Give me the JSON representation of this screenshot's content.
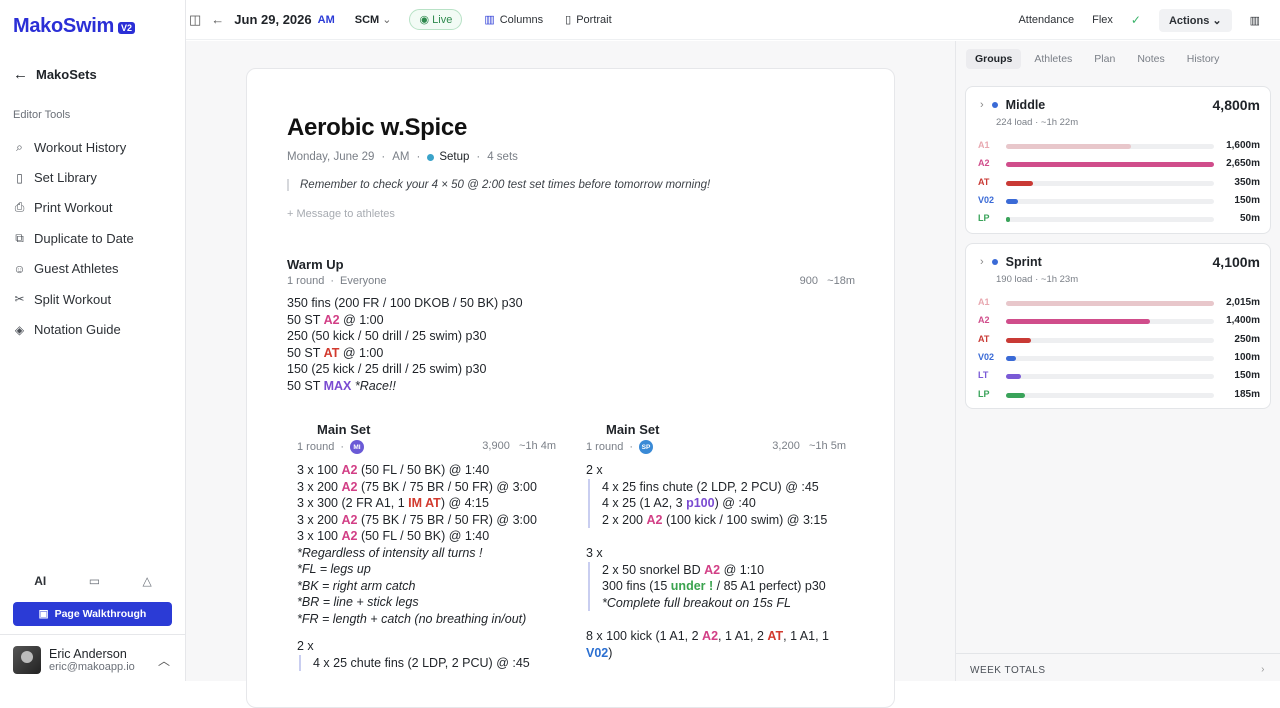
{
  "app": {
    "logo": "MakoSwim",
    "logo_badge": "V2"
  },
  "sidebar": {
    "back_label": "MakoSets",
    "section_label": "Editor Tools",
    "items": [
      {
        "label": "Workout History",
        "icon": "search-icon"
      },
      {
        "label": "Set Library",
        "icon": "book-icon"
      },
      {
        "label": "Print Workout",
        "icon": "printer-icon"
      },
      {
        "label": "Duplicate to Date",
        "icon": "copy-icon"
      },
      {
        "label": "Guest Athletes",
        "icon": "user-plus-icon"
      },
      {
        "label": "Split Workout",
        "icon": "scissors-icon"
      },
      {
        "label": "Notation Guide",
        "icon": "graduation-cap-icon"
      }
    ],
    "bottom_tabs": {
      "ai": "AI"
    },
    "walkthrough_label": "Page Walkthrough",
    "user": {
      "name": "Eric Anderson",
      "email": "eric@makoapp.io"
    }
  },
  "topbar": {
    "date": "Jun 29, 2026",
    "ampm": "AM",
    "course": "SCM",
    "live": "Live",
    "columns": "Columns",
    "portrait": "Portrait",
    "attendance": "Attendance",
    "flex": "Flex",
    "actions": "Actions"
  },
  "workout": {
    "title": "Aerobic w.Spice",
    "day": "Monday, June 29",
    "ampm": "AM",
    "type": "Setup",
    "sets": "4 sets",
    "note": "Remember to check your 4 × 50 @ 2:00 test set times before tomorrow morning!",
    "message_placeholder": "+ Message to athletes",
    "warmup": {
      "title": "Warm Up",
      "rounds": "1 round",
      "group": "Everyone",
      "distance": "900",
      "time": "~18m"
    },
    "main_left": {
      "title": "Main Set",
      "rounds": "1 round",
      "badge": "MI",
      "distance": "3,900",
      "time": "~1h 4m"
    },
    "main_right": {
      "title": "Main Set",
      "rounds": "1 round",
      "badge": "SP",
      "distance": "3,200",
      "time": "~1h 5m"
    }
  },
  "rpanel": {
    "tabs": [
      "Groups",
      "Athletes",
      "Plan",
      "Notes",
      "History"
    ],
    "groups": [
      {
        "name": "Middle",
        "total": "4,800m",
        "sub": "224 load · ~1h 22m",
        "bars": [
          {
            "label": "A1",
            "value": "1,600m",
            "fraction": 0.6,
            "color": "#e8c7cb",
            "label_color": "#e8a8b0"
          },
          {
            "label": "A2",
            "value": "2,650m",
            "fraction": 1.0,
            "color": "#d04d8b",
            "label_color": "#d04d8b"
          },
          {
            "label": "AT",
            "value": "350m",
            "fraction": 0.13,
            "color": "#c93a35",
            "label_color": "#c93a35"
          },
          {
            "label": "V02",
            "value": "150m",
            "fraction": 0.06,
            "color": "#3a6ad6",
            "label_color": "#3a6ad6"
          },
          {
            "label": "LP",
            "value": "50m",
            "fraction": 0.02,
            "color": "#3aa35a",
            "label_color": "#3aa35a"
          }
        ]
      },
      {
        "name": "Sprint",
        "total": "4,100m",
        "sub": "190 load · ~1h 23m",
        "bars": [
          {
            "label": "A1",
            "value": "2,015m",
            "fraction": 1.0,
            "color": "#e8c7cb",
            "label_color": "#e8a8b0"
          },
          {
            "label": "A2",
            "value": "1,400m",
            "fraction": 0.69,
            "color": "#d04d8b",
            "label_color": "#d04d8b"
          },
          {
            "label": "AT",
            "value": "250m",
            "fraction": 0.12,
            "color": "#c93a35",
            "label_color": "#c93a35"
          },
          {
            "label": "V02",
            "value": "100m",
            "fraction": 0.05,
            "color": "#3a6ad6",
            "label_color": "#3a6ad6"
          },
          {
            "label": "LT",
            "value": "150m",
            "fraction": 0.07,
            "color": "#7a5ad6",
            "label_color": "#7a5ad6"
          },
          {
            "label": "LP",
            "value": "185m",
            "fraction": 0.09,
            "color": "#3aa35a",
            "label_color": "#3aa35a"
          }
        ]
      }
    ],
    "week_totals": "WEEK TOTALS"
  }
}
